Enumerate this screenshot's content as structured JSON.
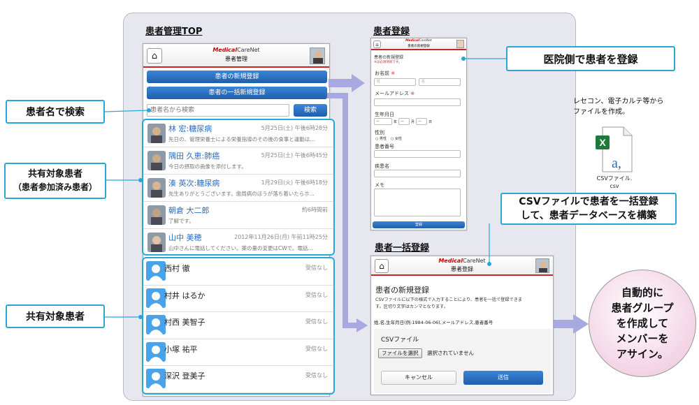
{
  "sections": {
    "patient_top": "患者管理TOP",
    "patient_register": "患者登録",
    "bulk_register": "患者一括登録"
  },
  "callouts": {
    "search": "患者名で検索",
    "shared_line1": "共有対象患者",
    "shared_line2": "（患者参加済み患者）",
    "shared2": "共有対象患者",
    "clinic_register": "医院側で患者を登録",
    "csv_line1": "CSVファイルで患者を一括登録",
    "csv_line2": "して、患者データベースを構築",
    "auto": [
      "自動的に",
      "患者グループ",
      "を作成して",
      "メンバーを",
      "アサイン。"
    ]
  },
  "recep_note": {
    "line1": "レセコン、電子カルテ等から",
    "line2": "ファイルを作成。",
    "file_label1": "CSVファイル.",
    "file_label2": "csv",
    "file_icon_letter": "a,",
    "x_letter": "X"
  },
  "app": {
    "logo_brand": "Medical",
    "logo_suffix": "CareNet",
    "home_icon": "⌂"
  },
  "main_phone": {
    "header_title": "患者管理",
    "btn_new": "患者の新規登録",
    "btn_bulk": "患者の一括新規登録",
    "search_placeholder": "患者名から検索",
    "search_btn": "検索",
    "shared": [
      {
        "name": "林 宏:糖尿病",
        "date": "5月25日(土) 午後6時28分",
        "msg": "先日の、管理栄養士による栄養指導のその後の食事と運動は..."
      },
      {
        "name": "隅田 久恵:肺癌",
        "date": "5月25日(土) 午後6時45分",
        "msg": "今日の摂取の画像を添付します。"
      },
      {
        "name": "湊 英次:糖尿病",
        "date": "1月29日(火) 午後6時18分",
        "msg": "先生ありがとうございます。歯周病のほうが落ち着いたらホ..."
      },
      {
        "name": "朝倉 大二郎",
        "date": "約6時間前",
        "msg": "了解です。"
      },
      {
        "name": "山中 美穂",
        "date": "2012年11月26日(月) 午前11時25分",
        "msg": "山中さんに電話してください。薬の量の変更はCWで。電話..."
      }
    ],
    "pending": [
      {
        "name": "西村 徹",
        "status": "受信なし"
      },
      {
        "name": "村井 はるか",
        "status": "受信なし"
      },
      {
        "name": "村西 美智子",
        "status": "受信なし"
      },
      {
        "name": "小塚 祐平",
        "status": "受信なし"
      },
      {
        "name": "深沢 登美子",
        "status": "受信なし"
      }
    ]
  },
  "reg_phone": {
    "header_title": "患者の新規登録",
    "form_title": "患者の新規登録",
    "required_note": "※は必須項目です。",
    "name_label": "お名前",
    "req_mark": "※",
    "last_ph": "姓",
    "first_ph": "名",
    "email_label": "メールアドレス",
    "dob_label": "生年月日",
    "year": "年",
    "month": "月",
    "day": "日",
    "dash": "－",
    "gender_label": "性別",
    "male": "男性",
    "female": "女性",
    "patient_no": "患者番号",
    "disease": "疾患名",
    "memo": "メモ",
    "submit": "登録"
  },
  "bulk_phone": {
    "header_title": "患者登録",
    "title": "患者の新規登録",
    "desc1": "CSVファイルに以下の様式で入力することにより、患者を一括で登録できま",
    "desc2": "す。区切り文字はカンマとなります。",
    "format": "姓,名,生年月日(例:1984-06-06),メールアドレス,患者番号",
    "csv_label": "CSVファイル",
    "choose_file": "ファイルを選択",
    "no_file": "選択されていません",
    "cancel": "キャンセル",
    "send": "送信"
  }
}
